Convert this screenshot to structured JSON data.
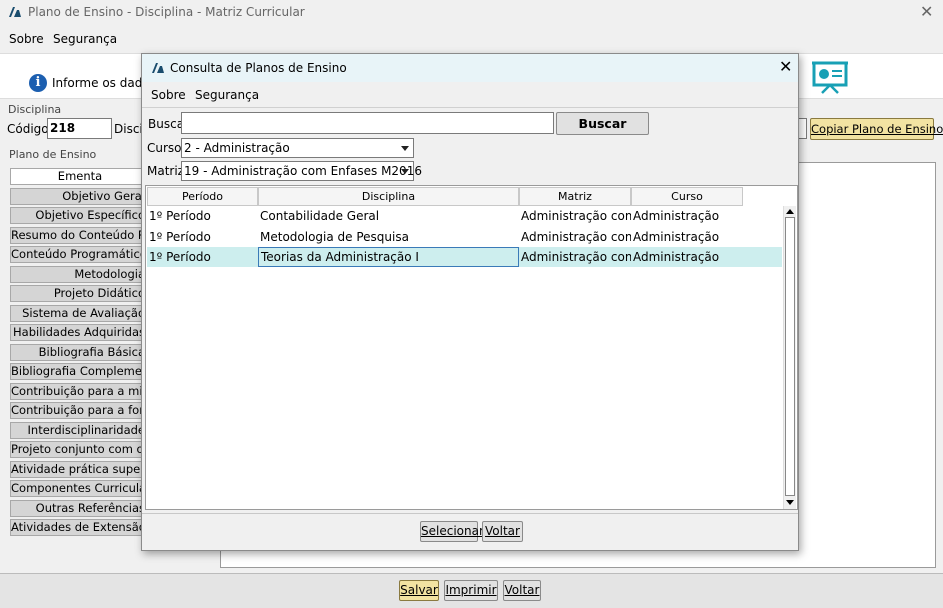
{
  "main_window": {
    "title": "Plano de Ensino - Disciplina - Matriz Curricular",
    "menu": [
      "Sobre",
      "Segurança"
    ],
    "info_text": "Informe os dados",
    "disciplina_group": "Disciplina",
    "codigo_label": "Código:",
    "codigo_value": "218",
    "disciplina_label_partial": "Discip",
    "copiar_button": "Copiar Plano de Ensino",
    "plano_group": "Plano de Ensino",
    "tabs": [
      "Ementa",
      "Objetivo Geral",
      "Objetivo Específico",
      "Resumo do Conteúdo Programático",
      "Conteúdo Programático",
      "Metodologia",
      "Projeto Didático",
      "Sistema de Avaliação",
      "Habilidades Adquiridas",
      "Bibliografia Básica",
      "Bibliografia Complementar",
      "Contribuição para a missão",
      "Contribuição para a formação",
      "Interdisciplinaridade",
      "Projeto conjunto com outras",
      "Atividade prática supervisionada",
      "Componentes Curriculares",
      "Outras Referências",
      "Atividades de Extensão"
    ],
    "bottom_buttons": {
      "salvar": "Salvar",
      "imprimir": "Imprimir",
      "voltar": "Voltar"
    }
  },
  "dialog": {
    "title": "Consulta de Planos de Ensino",
    "menu": [
      "Sobre",
      "Segurança"
    ],
    "busca_label": "Busca",
    "busca_value": "",
    "buscar_button": "Buscar",
    "curso_label": "Curso:",
    "curso_value": "2 - Administração",
    "matriz_label": "Matriz:",
    "matriz_value": "19 - Administração com Enfases M2016",
    "table": {
      "columns": [
        "Período",
        "Disciplina",
        "Matriz",
        "Curso"
      ],
      "rows": [
        [
          "1º Período",
          "Contabilidade Geral",
          "Administração com ...",
          "Administração"
        ],
        [
          "1º Período",
          "Metodologia de Pesquisa",
          "Administração com ...",
          "Administração"
        ],
        [
          "1º Período",
          "Teorias da Administração I",
          "Administração com ...",
          "Administração"
        ]
      ],
      "selected_row": 2
    },
    "selecionar_button": "Selecionar",
    "voltar_button": "Voltar"
  },
  "colors": {
    "accent_selected_row": "#cdeeee",
    "yellow_button": "#f2e3a2",
    "dialog_titlebar": "#e8f4f8"
  }
}
